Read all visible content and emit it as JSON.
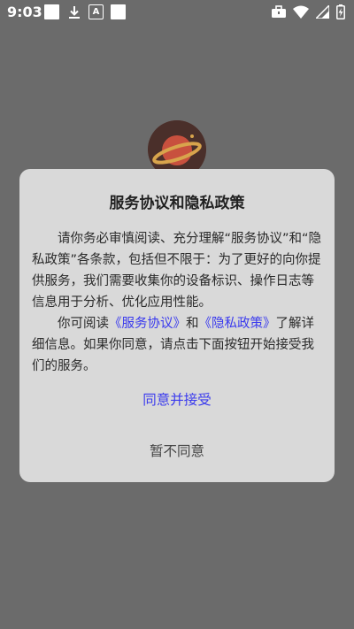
{
  "status_bar": {
    "time": "9:03",
    "left_icons": [
      "notification-square-icon",
      "download-icon",
      "text-a-icon",
      "notification-square-icon"
    ],
    "right_icons": [
      "briefcase-icon",
      "wifi-icon",
      "signal-icon",
      "battery-charging-icon"
    ]
  },
  "background": {
    "logo_icon": "planet-logo-icon"
  },
  "dialog": {
    "title": "服务协议和隐私政策",
    "paragraph1": "请你务必审慎阅读、充分理解“服务协议”和“隐私政策”各条款，包括但不限于：为了更好的向你提供服务，我们需要收集你的设备标识、操作日志等信息用于分析、优化应用性能。",
    "p2_prefix": "你可阅读",
    "service_link": "《服务协议》",
    "p2_and": "和",
    "privacy_link": "《隐私政策》",
    "p2_suffix": "了解详细信息。如果你同意，请点击下面按钮开始接受我们的服务。",
    "accept_label": "同意并接受",
    "decline_label": "暂不同意"
  },
  "colors": {
    "overlay": "#6b6b6b",
    "dialog_bg": "#d9d9d9",
    "link": "#3a3aee",
    "accept": "#3a3aee"
  }
}
